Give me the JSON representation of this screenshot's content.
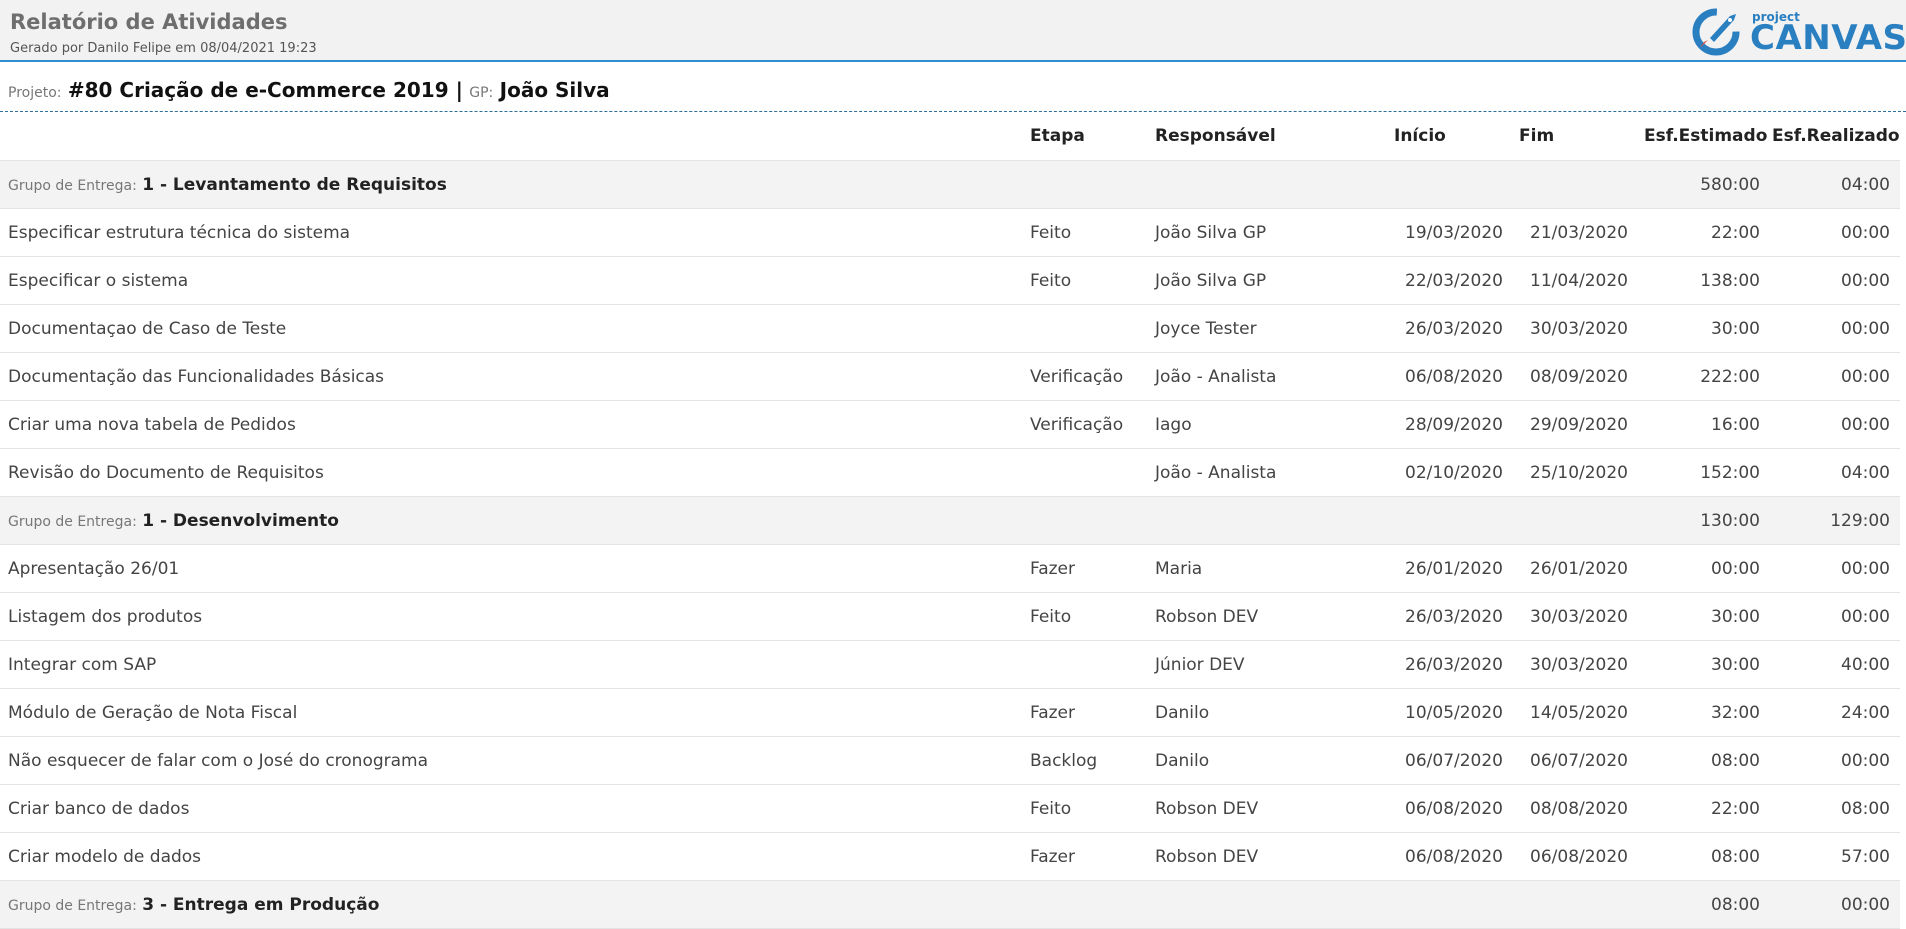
{
  "header": {
    "title": "Relatório de Atividades",
    "subtitle": "Gerado por Danilo Felipe em 08/04/2021 19:23",
    "logo_small": "project",
    "logo_big": "CANVAS",
    "logo_icon": "rocket-icon"
  },
  "project": {
    "label": "Projeto:",
    "name": "#80 Criação de e-Commerce 2019 |",
    "gp_label": "GP:",
    "gp_name": "João Silva"
  },
  "columns": {
    "etapa": "Etapa",
    "responsavel": "Responsável",
    "inicio": "Início",
    "fim": "Fim",
    "esf_estimado": "Esf.Estimado",
    "esf_realizado": "Esf.Realizado"
  },
  "groups": [
    {
      "label": "Grupo de Entrega:",
      "name": "1 - Levantamento de Requisitos",
      "estimado": "580:00",
      "realizado": "04:00",
      "rows": [
        {
          "desc": "Especificar estrutura técnica do sistema",
          "etapa": "Feito",
          "resp": "João Silva GP",
          "inicio": "19/03/2020",
          "fim": "21/03/2020",
          "est": "22:00",
          "real": "00:00"
        },
        {
          "desc": "Especificar o sistema",
          "etapa": "Feito",
          "resp": "João Silva GP",
          "inicio": "22/03/2020",
          "fim": "11/04/2020",
          "est": "138:00",
          "real": "00:00"
        },
        {
          "desc": "Documentaçao de Caso de Teste",
          "etapa": "",
          "resp": "Joyce Tester",
          "inicio": "26/03/2020",
          "fim": "30/03/2020",
          "est": "30:00",
          "real": "00:00"
        },
        {
          "desc": "Documentação das Funcionalidades Básicas",
          "etapa": "Verificação",
          "resp": "João - Analista",
          "inicio": "06/08/2020",
          "fim": "08/09/2020",
          "est": "222:00",
          "real": "00:00"
        },
        {
          "desc": "Criar uma nova tabela de Pedidos",
          "etapa": "Verificação",
          "resp": "Iago",
          "inicio": "28/09/2020",
          "fim": "29/09/2020",
          "est": "16:00",
          "real": "00:00"
        },
        {
          "desc": "Revisão do Documento de Requisitos",
          "etapa": "",
          "resp": "João - Analista",
          "inicio": "02/10/2020",
          "fim": "25/10/2020",
          "est": "152:00",
          "real": "04:00"
        }
      ]
    },
    {
      "label": "Grupo de Entrega:",
      "name": "1 - Desenvolvimento",
      "estimado": "130:00",
      "realizado": "129:00",
      "rows": [
        {
          "desc": "Apresentação 26/01",
          "etapa": "Fazer",
          "resp": "Maria",
          "inicio": "26/01/2020",
          "fim": "26/01/2020",
          "est": "00:00",
          "real": "00:00"
        },
        {
          "desc": "Listagem dos produtos",
          "etapa": "Feito",
          "resp": "Robson DEV",
          "inicio": "26/03/2020",
          "fim": "30/03/2020",
          "est": "30:00",
          "real": "00:00"
        },
        {
          "desc": "Integrar com SAP",
          "etapa": "",
          "resp": "Júnior DEV",
          "inicio": "26/03/2020",
          "fim": "30/03/2020",
          "est": "30:00",
          "real": "40:00"
        },
        {
          "desc": "Módulo de Geração de Nota Fiscal",
          "etapa": "Fazer",
          "resp": "Danilo",
          "inicio": "10/05/2020",
          "fim": "14/05/2020",
          "est": "32:00",
          "real": "24:00"
        },
        {
          "desc": "Não esquecer de falar com o José do cronograma",
          "etapa": "Backlog",
          "resp": "Danilo",
          "inicio": "06/07/2020",
          "fim": "06/07/2020",
          "est": "08:00",
          "real": "00:00"
        },
        {
          "desc": "Criar banco de dados",
          "etapa": "Feito",
          "resp": "Robson DEV",
          "inicio": "06/08/2020",
          "fim": "08/08/2020",
          "est": "22:00",
          "real": "08:00"
        },
        {
          "desc": "Criar modelo de dados",
          "etapa": "Fazer",
          "resp": "Robson DEV",
          "inicio": "06/08/2020",
          "fim": "06/08/2020",
          "est": "08:00",
          "real": "57:00"
        }
      ]
    },
    {
      "label": "Grupo de Entrega:",
      "name": "3 - Entrega em Produção",
      "estimado": "08:00",
      "realizado": "00:00",
      "rows": []
    }
  ]
}
